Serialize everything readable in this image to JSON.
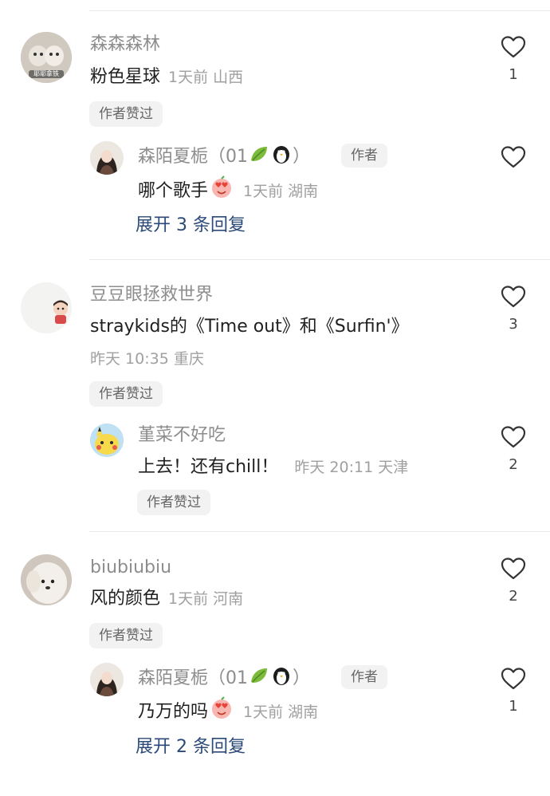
{
  "comments": [
    {
      "user": "森森森林",
      "avatar_caption": "耶耶拿铁",
      "text": "粉色星球",
      "meta": "1天前 山西",
      "author_liked": "作者赞过",
      "likes": "1",
      "reply": {
        "user_prefix": "森陌夏栀（01",
        "user_suffix": "）",
        "author_tag": "作者",
        "text": "哪个歌手",
        "meta": "1天前 湖南",
        "likes": ""
      },
      "expand": "展开 3 条回复"
    },
    {
      "user": "豆豆眼拯救世界",
      "text": "straykids的《Time out》和《Surfin'》",
      "meta": "昨天 10:35 重庆",
      "author_liked": "作者赞过",
      "likes": "3",
      "reply": {
        "user": "堇菜不好吃",
        "text": "上去！还有chill！",
        "meta": "昨天 20:11 天津",
        "author_liked": "作者赞过",
        "likes": "2"
      }
    },
    {
      "user": "biubiubiu",
      "text": "风的颜色",
      "meta": "1天前 河南",
      "author_liked": "作者赞过",
      "likes": "2",
      "reply": {
        "user_prefix": "森陌夏栀（01",
        "user_suffix": "）",
        "author_tag": "作者",
        "text": "乃万的吗",
        "meta": "1天前 湖南",
        "likes": "1"
      },
      "expand": "展开 2 条回复"
    }
  ],
  "icons": {
    "like": "heart-outline-icon",
    "leaf": "leaf-emoji",
    "penguin": "penguin-emoji",
    "heart_eyes": "heart-eyes-emoji"
  },
  "colors": {
    "expand_link": "#2b4a78",
    "username": "#8d8d8d",
    "meta": "#a0a0a0",
    "pill_bg": "#f2f2f2"
  }
}
